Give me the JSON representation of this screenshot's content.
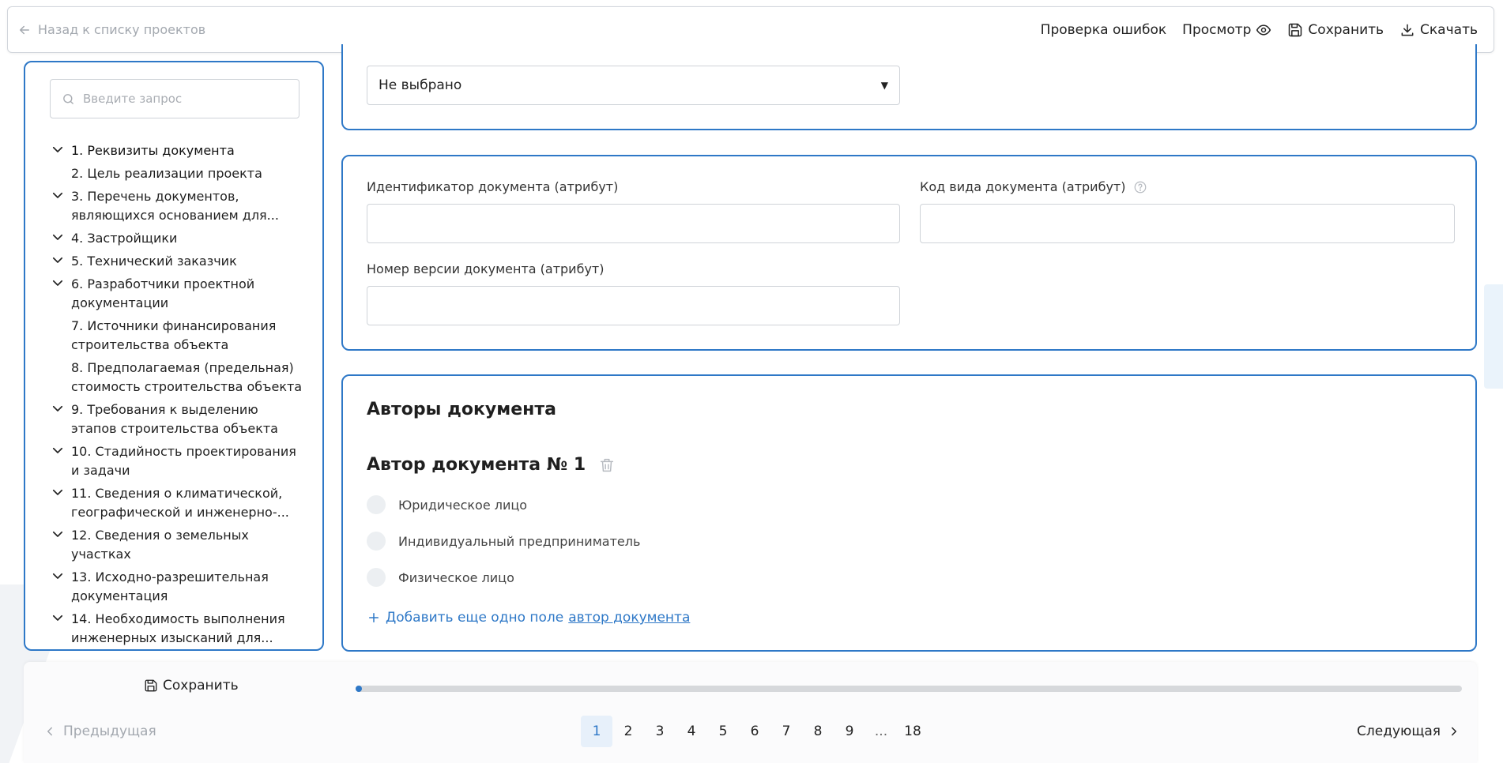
{
  "header": {
    "back_label": "Назад к списку проектов",
    "actions": {
      "check_errors": "Проверка ошибок",
      "preview": "Просмотр",
      "save": "Сохранить",
      "download": "Скачать"
    }
  },
  "sidebar": {
    "search_placeholder": "Введите запрос",
    "items": [
      {
        "line1": "1. Реквизиты документа",
        "line2": "",
        "expandable": true
      },
      {
        "line1": "2. Цель реализации проекта",
        "line2": "",
        "expandable": false
      },
      {
        "line1": "3. Перечень документов,",
        "line2": "являющихся основанием для...",
        "expandable": true
      },
      {
        "line1": "4. Застройщики",
        "line2": "",
        "expandable": true
      },
      {
        "line1": "5. Технический заказчик",
        "line2": "",
        "expandable": true
      },
      {
        "line1": "6. Разработчики проектной",
        "line2": "документации",
        "expandable": true
      },
      {
        "line1": "7. Источники финансирования",
        "line2": "строительства объекта",
        "expandable": false
      },
      {
        "line1": "8. Предполагаемая (предельная)",
        "line2": "стоимость строительства объекта",
        "expandable": false
      },
      {
        "line1": "9. Требования к выделению",
        "line2": "этапов строительства объекта",
        "expandable": true
      },
      {
        "line1": "10. Стадийность проектирования",
        "line2": "и задачи",
        "expandable": true
      },
      {
        "line1": "11. Сведения о климатической,",
        "line2": "географической и инженерно-...",
        "expandable": true
      },
      {
        "line1": "12. Сведения о земельных",
        "line2": "участках",
        "expandable": true
      },
      {
        "line1": "13. Исходно-разрешительная",
        "line2": "документация",
        "expandable": true
      },
      {
        "line1": "14. Необходимость выполнения",
        "line2": "инженерных изысканий для...",
        "expandable": true
      }
    ]
  },
  "card1": {
    "select_value": "Не выбрано"
  },
  "card2": {
    "doc_id_label": "Идентификатор документа (атрибут)",
    "doc_kind_label": "Код вида документа (атрибут)",
    "version_label": "Номер версии документа (атрибут)"
  },
  "authors": {
    "title": "Авторы документа",
    "author_title": "Автор документа № 1",
    "options": [
      "Юридическое лицо",
      "Индивидуальный предприниматель",
      "Физическое лицо"
    ],
    "add_prefix": "Добавить еще одно поле",
    "add_link": "автор документа"
  },
  "footer": {
    "save": "Сохранить",
    "progress": 0.004,
    "prev": "Предыдущая",
    "next": "Следующая",
    "pages": [
      "1",
      "2",
      "3",
      "4",
      "5",
      "6",
      "7",
      "8",
      "9",
      "...",
      "18"
    ],
    "current_page": "1"
  },
  "colors": {
    "accent": "#2e78c7",
    "muted": "#a3a8af"
  }
}
